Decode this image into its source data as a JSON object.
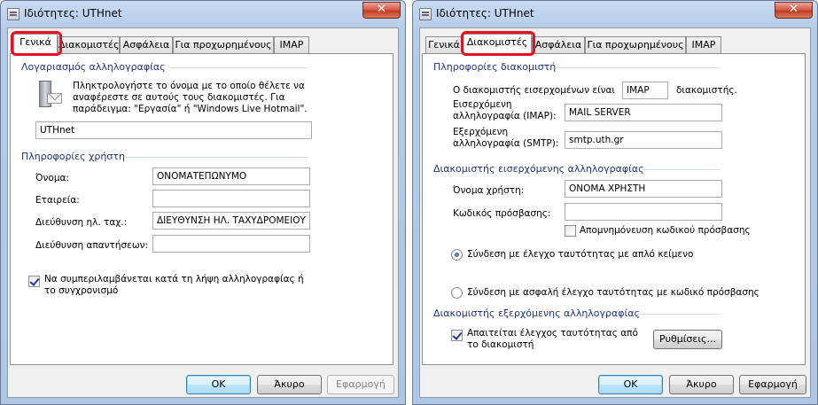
{
  "left": {
    "title": "Ιδιότητες: UTHnet",
    "close_label": "✕",
    "tabs": [
      "Γενικά",
      "Διακομιστές",
      "Ασφάλεια",
      "Για προχωρημένους",
      "IMAP"
    ],
    "mail_account": {
      "heading": "Λογαριασμός αλληλογραφίας",
      "description": "Πληκτρολογήστε το όνομα με το οποίο θέλετε να αναφέρεστε σε αυτούς τους διακομιστές. Για παράδειγμα: \"Εργασία\" ή \"Windows Live Hotmail\".",
      "account_name": "UTHnet"
    },
    "user_info": {
      "heading": "Πληροφορίες χρήστη",
      "name_label": "Όνομα:",
      "name_value": "ΟΝΟΜΑΤΕΠΩΝΥΜΟ",
      "company_label": "Εταιρεία:",
      "company_value": "",
      "email_label": "Διεύθυνση ηλ. ταχ.:",
      "email_value": "ΔΙΕΥΘΥΝΣΗ ΗΛ. ΤΑΧΥΔΡΟΜΕΙΟΥ",
      "reply_label": "Διεύθυνση απαντήσεων:",
      "reply_value": ""
    },
    "include_label": "Να συμπεριλαμβάνεται κατά τη λήψη αλληλογραφίας ή το συγχρονισμό",
    "buttons": {
      "ok": "OK",
      "cancel": "Άκυρο",
      "apply": "Εφαρμογή"
    }
  },
  "right": {
    "title": "Ιδιότητες: UTHnet",
    "close_label": "✕",
    "tabs": [
      "Γενικά",
      "Διακομιστές",
      "Ασφάλεια",
      "Για προχωρημένους",
      "IMAP"
    ],
    "server_info": {
      "heading": "Πληροφορίες διακομιστή",
      "incoming_prefix": "Ο διακομιστής εισερχομένων είναι",
      "incoming_type": "IMAP",
      "incoming_suffix": "διακομιστής.",
      "incoming_label": "Εισερχόμενη αλληλογραφία (IMAP):",
      "incoming_value": "MAIL SERVER",
      "outgoing_label": "Εξερχόμενη αλληλογραφία (SMTP):",
      "outgoing_value": "smtp.uth.gr"
    },
    "incoming_server": {
      "heading": "Διακομιστής εισερχόμενης αλληλογραφίας",
      "username_label": "Όνομα χρήστη:",
      "username_value": "ΟΝΟΜΑ ΧΡΗΣΤΗ",
      "password_label": "Κωδικός πρόσβασης:",
      "password_value": "",
      "remember_label": "Απομνημόνευση κωδικού πρόσβασης",
      "clear_auth_label": "Σύνδεση με έλεγχο ταυτότητας με απλό κείμενο",
      "secure_auth_label": "Σύνδεση με ασφαλή έλεγχο ταυτότητας με κωδικό πρόσβασης"
    },
    "outgoing_server": {
      "heading": "Διακομιστής εξερχόμενης αλληλογραφίας",
      "requires_auth_label": "Απαιτείται έλεγχος ταυτότητας από το διακομιστή",
      "settings_button": "Ρυθμίσεις..."
    },
    "buttons": {
      "ok": "OK",
      "cancel": "Άκυρο",
      "apply": "Εφαρμογή"
    }
  },
  "colors": {
    "highlight": "#e81020",
    "group_heading": "#1e3287",
    "window_frame": "#b6cde9"
  }
}
